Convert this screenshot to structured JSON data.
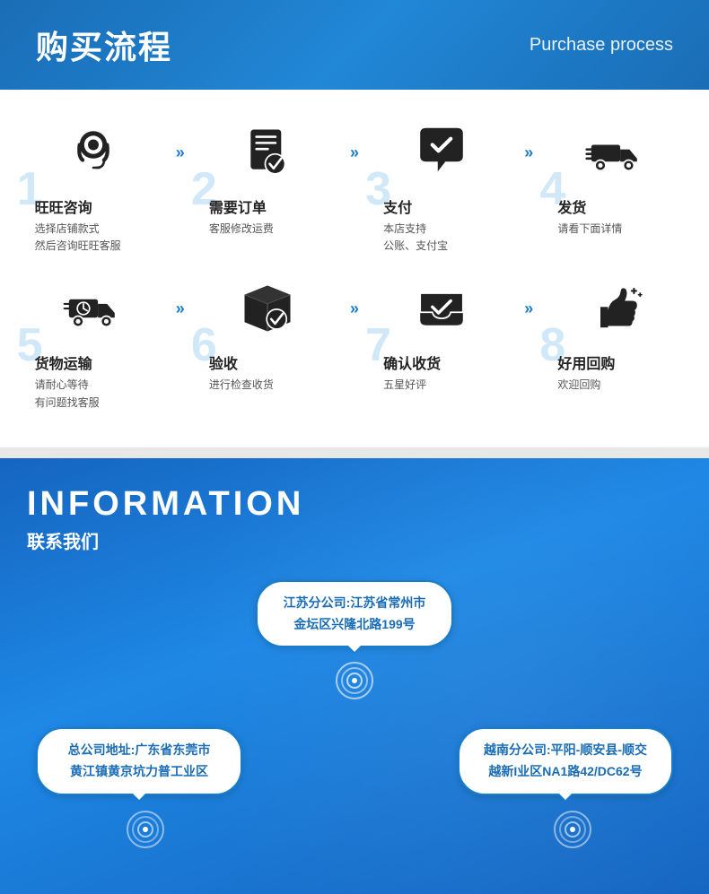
{
  "header": {
    "title": "购买流程",
    "subtitle": "Purchase process"
  },
  "process": {
    "row1": [
      {
        "number": "1",
        "title": "旺旺咨询",
        "desc": "选择店铺款式\n然后咨询旺旺客服",
        "icon": "headset"
      },
      {
        "number": "2",
        "title": "需要订单",
        "desc": "客服修改运费",
        "icon": "document"
      },
      {
        "number": "3",
        "title": "支付",
        "desc": "本店支持\n公账、支付宝",
        "icon": "checkbubble"
      },
      {
        "number": "4",
        "title": "发货",
        "desc": "请看下面详情",
        "icon": "truck-fast"
      }
    ],
    "row2": [
      {
        "number": "5",
        "title": "货物运输",
        "desc": "请耐心等待\n有问题找客服",
        "icon": "truck-clock"
      },
      {
        "number": "6",
        "title": "验收",
        "desc": "进行检查收货",
        "icon": "box-check"
      },
      {
        "number": "7",
        "title": "确认收货",
        "desc": "五星好评",
        "icon": "inbox-check"
      },
      {
        "number": "8",
        "title": "好用回购",
        "desc": "欢迎回购",
        "icon": "thumbs-up"
      }
    ]
  },
  "information": {
    "title_en": "INFORMATION",
    "title_cn": "联系我们",
    "locations": {
      "jiangsu": "江苏分公司:江苏省常州市\n金坛区兴隆北路199号",
      "guangdong": "总公司地址:广东省东莞市\n黄江镇黄京坑力普工业区",
      "vietnam": "越南分公司:平阳-顺安县-顺交\n越新I业区NA1路42/DC62号"
    }
  }
}
